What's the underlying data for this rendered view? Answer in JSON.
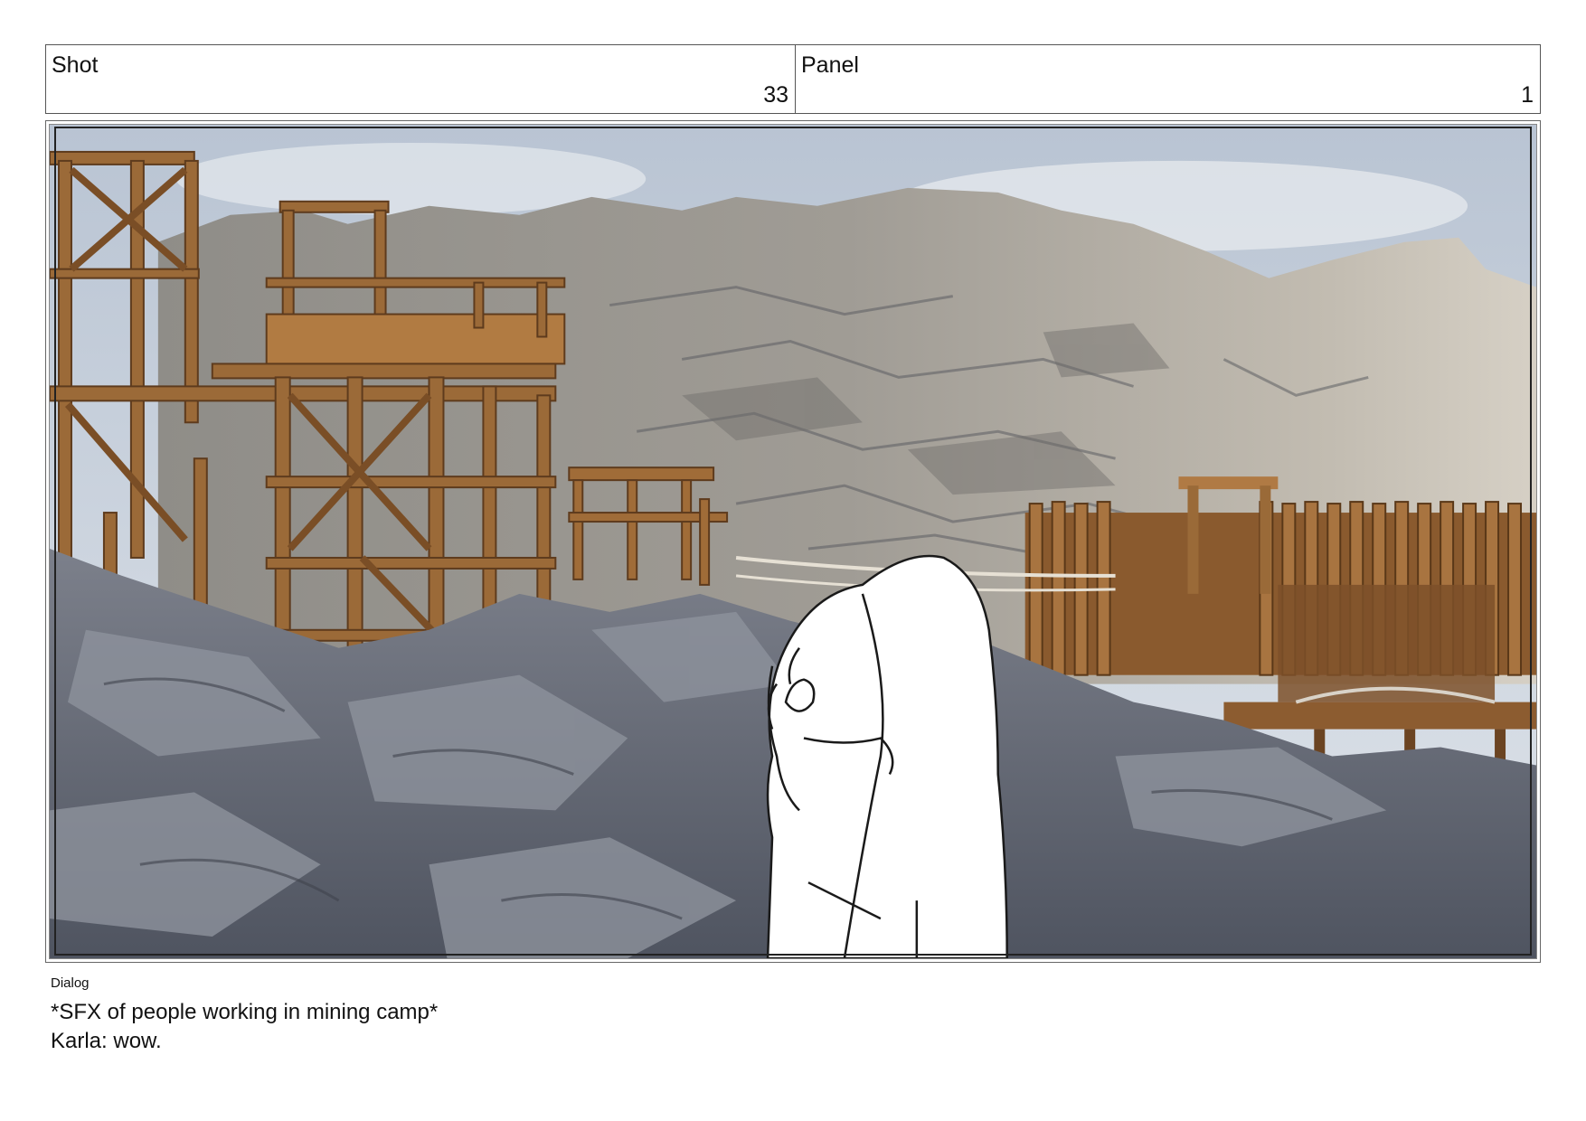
{
  "header": {
    "shot_label": "Shot",
    "shot_number": "33",
    "panel_label": "Panel",
    "panel_number": "1"
  },
  "panel_image": {
    "scene": "mining-camp-on-rocky-cliff",
    "character": "Karla",
    "colors": {
      "sky": "#c9d2de",
      "rock_light": "#a7a49d",
      "rock_dark": "#545a66",
      "wood": "#9b6a38",
      "wood_dark": "#5e3b1d",
      "character_fill": "#ffffff",
      "character_line": "#1a1a1a"
    }
  },
  "dialog": {
    "label": "Dialog",
    "lines": [
      "*SFX of people working in mining camp*",
      "Karla: wow."
    ]
  }
}
